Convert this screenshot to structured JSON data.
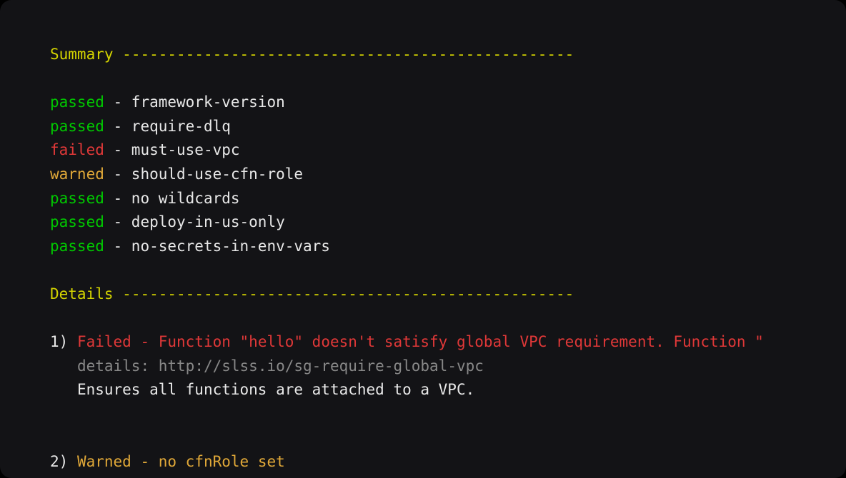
{
  "sections": {
    "summary_header": "Summary",
    "details_header": "Details",
    "summary_dashes": "--------------------------------------------------",
    "details_dashes": "--------------------------------------------------"
  },
  "summary": [
    {
      "status": "passed",
      "name": "framework-version",
      "class": "green"
    },
    {
      "status": "passed",
      "name": "require-dlq",
      "class": "green"
    },
    {
      "status": "failed",
      "name": "must-use-vpc",
      "class": "red"
    },
    {
      "status": "warned",
      "name": "should-use-cfn-role",
      "class": "orange"
    },
    {
      "status": "passed",
      "name": "no wildcards",
      "class": "green"
    },
    {
      "status": "passed",
      "name": "deploy-in-us-only",
      "class": "green"
    },
    {
      "status": "passed",
      "name": "no-secrets-in-env-vars",
      "class": "green"
    }
  ],
  "separator": " - ",
  "details": [
    {
      "number": "1)",
      "status": "Failed",
      "status_class": "red",
      "message": " - Function \"hello\" doesn't satisfy global VPC requirement. Function \"",
      "details_label": "details:",
      "details_url": "http://slss.io/sg-require-global-vpc",
      "description": "Ensures all functions are attached to a VPC."
    },
    {
      "number": "2)",
      "status": "Warned",
      "status_class": "orange",
      "message": " - no cfnRole set"
    }
  ],
  "indent": "   "
}
